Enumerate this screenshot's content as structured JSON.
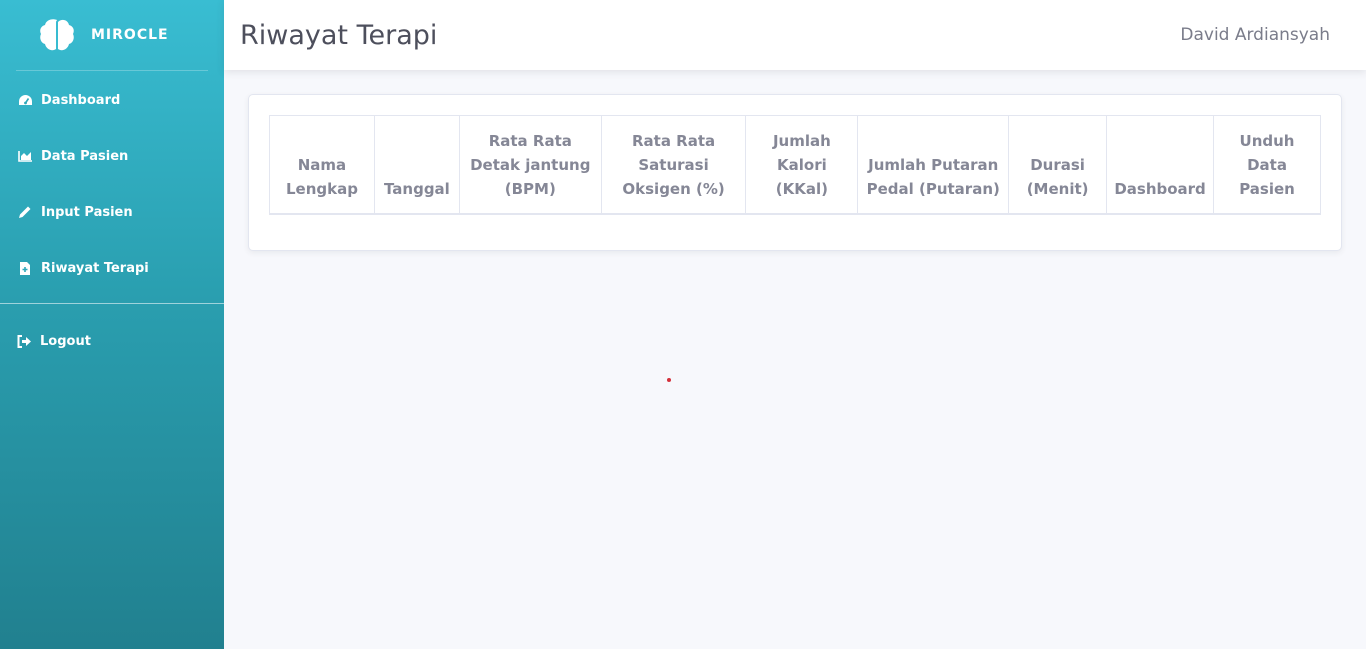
{
  "app": {
    "brand": "MIROCLE"
  },
  "sidebar": {
    "items": [
      {
        "label": "Dashboard",
        "icon": "tachometer-icon"
      },
      {
        "label": "Data Pasien",
        "icon": "chart-area-icon"
      },
      {
        "label": "Input Pasien",
        "icon": "pencil-icon"
      },
      {
        "label": "Riwayat Terapi",
        "icon": "file-medical-icon"
      }
    ],
    "logout": {
      "label": "Logout",
      "icon": "sign-out-icon"
    }
  },
  "header": {
    "title": "Riwayat Terapi",
    "user": "David Ardiansyah"
  },
  "table": {
    "columns": [
      "Nama Lengkap",
      "Tanggal",
      "Rata Rata Detak jantung (BPM)",
      "Rata Rata Saturasi Oksigen (%)",
      "Jumlah Kalori (KKal)",
      "Jumlah Putaran Pedal (Putaran)",
      "Durasi (Menit)",
      "Dashboard",
      "Unduh Data Pasien"
    ],
    "rows": []
  },
  "colors": {
    "sidebar_top": "#39bdd2",
    "sidebar_bottom": "#21808f",
    "text_muted": "#858796"
  }
}
